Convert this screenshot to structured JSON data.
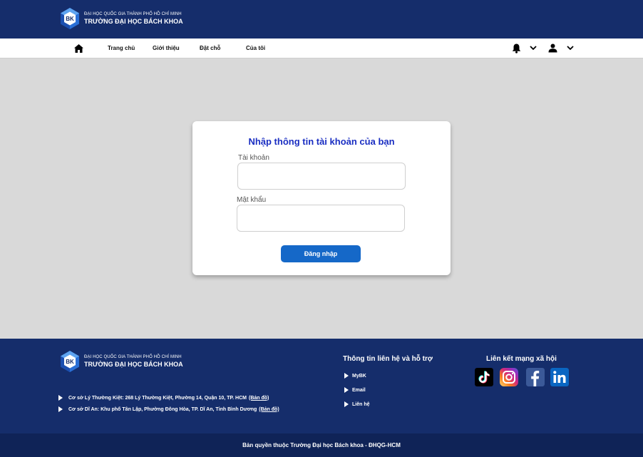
{
  "brand": {
    "sub": "ĐẠI HỌC QUỐC GIA THÀNH PHỐ HỒ CHÍ MINH",
    "main": "TRƯỜNG ĐẠI HỌC BÁCH KHOA",
    "logo_text": "BK"
  },
  "nav": {
    "items": [
      {
        "label": "Trang chủ"
      },
      {
        "label": "Giới thiệu"
      },
      {
        "label": "Đặt chỗ"
      },
      {
        "label": "Của tôi"
      }
    ],
    "icons": [
      "home-icon",
      "bell-icon",
      "chevron-down-icon",
      "user-icon",
      "chevron-down-icon"
    ]
  },
  "login": {
    "title": "Nhập thông tin tài khoản của bạn",
    "username_label": "Tài khoản",
    "username_value": "",
    "password_label": "Mật khẩu",
    "password_value": "",
    "submit_label": "Đăng nhập"
  },
  "footer": {
    "addresses": [
      {
        "text": "Cơ sở Lý Thường Kiệt: 268 Lý Thường Kiệt, Phường 14, Quận 10, TP. HCM",
        "link": "(Bản đồ)"
      },
      {
        "text": "Cơ sở Dĩ An: Khu phố Tân Lập, Phường Đông Hòa, TP. Dĩ An, Tỉnh Bình Dương",
        "link": "(Bản đồ)"
      }
    ],
    "contact_title": "Thông tin liên hệ và hỗ trợ",
    "contact_links": [
      {
        "label": "MyBK"
      },
      {
        "label": "Email"
      },
      {
        "label": "Liên hệ"
      }
    ],
    "social_title": "Liên kết mạng xã hội",
    "social": [
      "tiktok-icon",
      "instagram-icon",
      "facebook-icon",
      "linkedin-icon"
    ],
    "copyright": "Bản quyền thuộc Trường Đại học Bách khoa - ĐHQG-HCM"
  },
  "colors": {
    "header_bg": "#152d6b",
    "copyright_bg": "#0f2357",
    "title": "#1a2ec2",
    "button": "#1568c8",
    "page_bg": "#d9d9d9"
  }
}
